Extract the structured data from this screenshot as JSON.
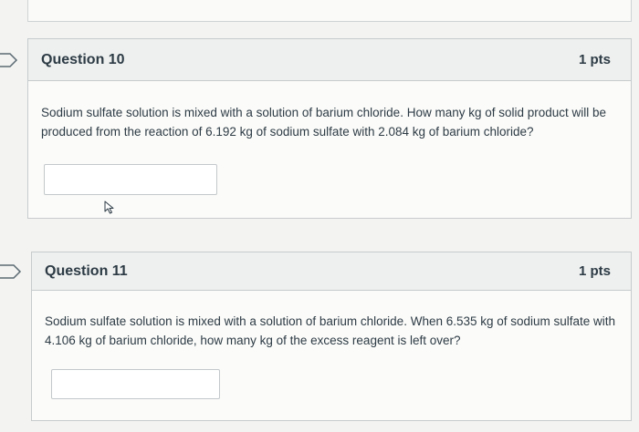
{
  "questions": [
    {
      "title": "Question 10",
      "points": "1 pts",
      "text": "Sodium sulfate solution is mixed with a solution of barium chloride. How many kg of solid product will be produced from the reaction of 6.192 kg of sodium sulfate with 2.084 kg of barium chloride?",
      "answer_value": ""
    },
    {
      "title": "Question 11",
      "points": "1 pts",
      "text": "Sodium sulfate solution is mixed with a solution of barium chloride. When 6.535 kg of sodium sulfate with 4.106 kg of barium chloride, how many kg of the excess reagent is left over?",
      "answer_value": ""
    }
  ],
  "icons": {
    "flag": "flag-outline-icon",
    "cursor": "mouse-pointer-icon"
  },
  "colors": {
    "background": "#f3f3f1",
    "header": "#eef0ef",
    "border": "#c7cbcc",
    "text": "#2d3b45"
  }
}
